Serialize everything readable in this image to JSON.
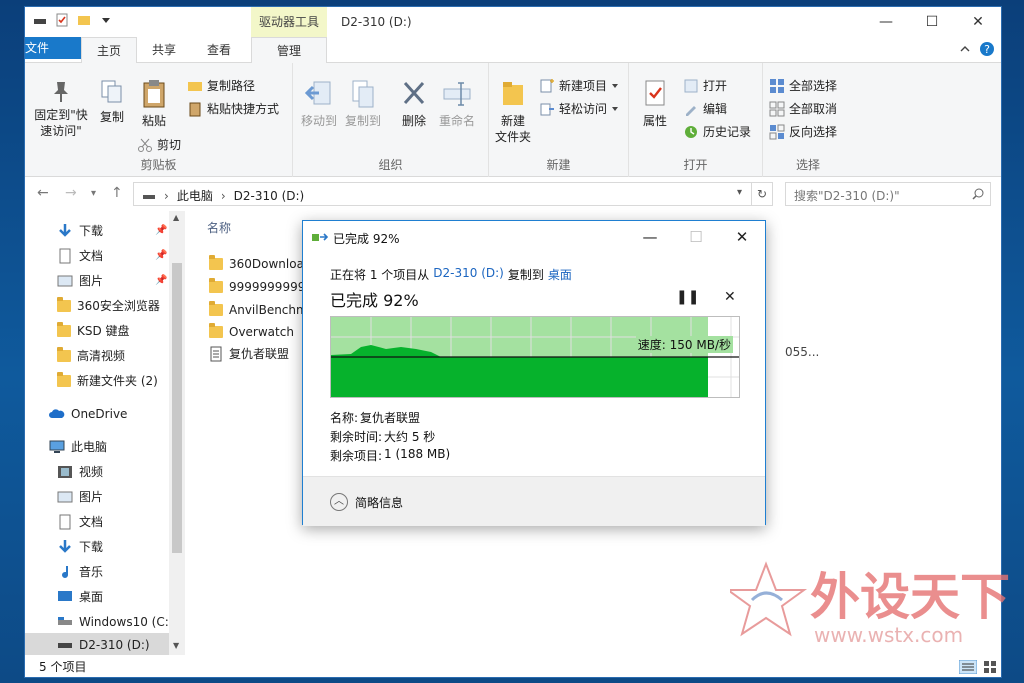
{
  "window": {
    "title": "D2-310 (D:)",
    "context_tab": "驱动器工具",
    "btn_min": "—",
    "btn_max": "☐",
    "btn_close": "✕"
  },
  "tabs": {
    "file": "文件",
    "home": "主页",
    "share": "共享",
    "view": "查看",
    "manage": "管理"
  },
  "ribbon": {
    "clipboard": {
      "label": "剪贴板",
      "pin": "固定到\"快",
      "pin2": "速访问\"",
      "copy": "复制",
      "paste": "粘贴",
      "copy_path": "复制路径",
      "paste_shortcut": "粘贴快捷方式",
      "cut": "剪切"
    },
    "organize": {
      "label": "组织",
      "move_to": "移动到",
      "copy_to": "复制到",
      "delete": "删除",
      "rename": "重命名"
    },
    "new": {
      "label": "新建",
      "new_folder": "新建",
      "new_folder2": "文件夹",
      "new_item": "新建项目",
      "easy_access": "轻松访问"
    },
    "open": {
      "label": "打开",
      "properties": "属性",
      "open": "打开",
      "edit": "编辑",
      "history": "历史记录"
    },
    "select": {
      "label": "选择",
      "select_all": "全部选择",
      "select_none": "全部取消",
      "invert": "反向选择"
    }
  },
  "address": {
    "pc": "此电脑",
    "drive": "D2-310 (D:)",
    "search_placeholder": "搜索\"D2-310 (D:)\""
  },
  "nav": {
    "items": [
      "下载",
      "文档",
      "图片",
      "360安全浏览器",
      "KSD 键盘",
      "高清视频",
      "新建文件夹 (2)",
      "OneDrive",
      "此电脑",
      "视频",
      "图片",
      "文档",
      "下载",
      "音乐",
      "桌面",
      "Windows10 (C:",
      "D2-310 (D:)"
    ]
  },
  "content": {
    "col_name": "名称",
    "files": [
      "360Downloa",
      "9999999999",
      "AnvilBenchm",
      "Overwatch",
      "复仇者联盟"
    ],
    "extra_text": "055..."
  },
  "status": {
    "count": "5 个项目"
  },
  "dialog": {
    "title": "已完成 92%",
    "line1_pre": "正在将 1 个项目从",
    "line1_src": "D2-310 (D:)",
    "line1_mid": "复制到",
    "line1_dst": "桌面",
    "percent_text": "已完成 92%",
    "progress": 0.92,
    "speed": "速度: 150 MB/秒",
    "name_label": "名称:",
    "name_value": "复仇者联盟",
    "time_label": "剩余时间:",
    "time_value": "大约 5 秒",
    "items_label": "剩余项目:",
    "items_value": "1 (188 MB)",
    "less_details": "简略信息",
    "pause": "❚❚",
    "cancel": "✕"
  },
  "watermark": {
    "brand": "外设天下",
    "url": "www.wstx.com"
  },
  "colors": {
    "accent": "#1979ca",
    "progress_light": "#a4e1a0",
    "progress_dark": "#06b22c",
    "context_tab": "#f3f7c9"
  }
}
